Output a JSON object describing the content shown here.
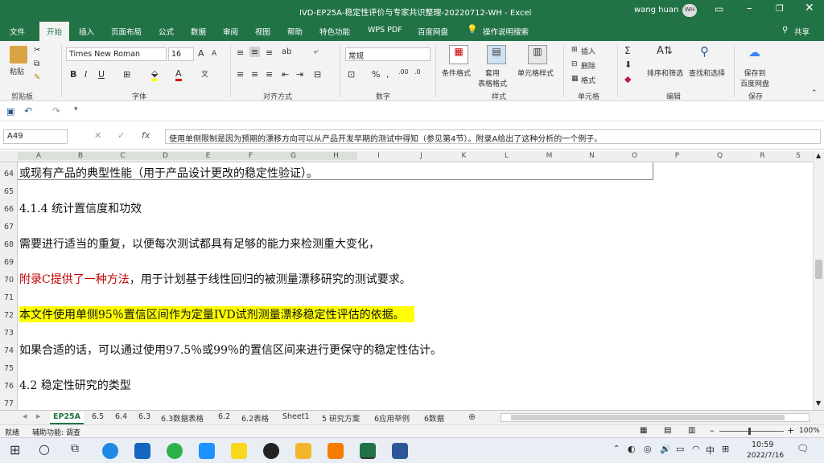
{
  "window": {
    "title": "IVD-EP25A-稳定性评价与专家共识整理-20220712-WH  -  Excel",
    "user": "wang huan",
    "avatar": "WH",
    "share": "共享"
  },
  "tabs": [
    "文件",
    "开始",
    "插入",
    "页面布局",
    "公式",
    "数据",
    "审阅",
    "视图",
    "帮助",
    "特色功能",
    "WPS PDF",
    "百度网盘",
    "操作说明搜索"
  ],
  "active_tab": "开始",
  "ribbon": {
    "paste": "粘贴",
    "font_name": "Times New Roman",
    "font_size": "16",
    "number_format": "常规",
    "cond_format": "条件格式",
    "table_format": "套用\n表格格式",
    "cell_style": "单元格样式",
    "insert": "插入",
    "delete": "删除",
    "format": "格式",
    "sort_filter": "排序和筛选",
    "find_select": "查找和选择",
    "save_baidu": "保存到\n百度网盘",
    "groups": [
      "剪贴板",
      "字体",
      "对齐方式",
      "数字",
      "样式",
      "单元格",
      "编辑",
      "保存"
    ]
  },
  "formula_bar": {
    "name_box": "A49",
    "fx": "fx",
    "content": "使用单侧限制是因为预期的漂移方向可以从产品开发早期的测试中得知（参见第4节）。附录A给出了这种分析的一个例子。"
  },
  "columns": [
    "A",
    "B",
    "C",
    "D",
    "E",
    "F",
    "G",
    "H",
    "I",
    "J",
    "K",
    "L",
    "M",
    "N",
    "O",
    "P",
    "Q",
    "R",
    "S"
  ],
  "rows": [
    {
      "num": "64",
      "text": "或现有产品的典型性能（用于产品设计更改的稳定性验证）。",
      "style": ""
    },
    {
      "num": "65",
      "text": "",
      "style": ""
    },
    {
      "num": "66",
      "text": "4.1.4 统计置信度和功效",
      "style": ""
    },
    {
      "num": "67",
      "text": "",
      "style": ""
    },
    {
      "num": "68",
      "text": "需要进行适当的重复，以便每次测试都具有足够的能力来检测重大变化，",
      "style": ""
    },
    {
      "num": "69",
      "text": "",
      "style": ""
    },
    {
      "num": "70",
      "text_red": "附录C提供了一种方法",
      "text": "，用于计划基于线性回归的被测量漂移研究的测试要求。",
      "style": "red"
    },
    {
      "num": "71",
      "text": "",
      "style": ""
    },
    {
      "num": "72",
      "text": "本文件使用单侧95％置信区间作为定量IVD试剂测量漂移稳定性评估的依据。",
      "style": "hl"
    },
    {
      "num": "73",
      "text": "",
      "style": ""
    },
    {
      "num": "74",
      "text": "如果合适的话，可以通过使用97.5％或99％的置信区间来进行更保守的稳定性估计。",
      "style": ""
    },
    {
      "num": "75",
      "text": "",
      "style": ""
    },
    {
      "num": "76",
      "text": "4.2 稳定性研究的类型",
      "style": ""
    },
    {
      "num": "77",
      "text": "",
      "style": ""
    }
  ],
  "sheet_tabs": [
    "EP25A",
    "6.5",
    "6.4",
    "6.3",
    "6.3数据表格",
    "6.2",
    "6.2表格",
    "Sheet1",
    "5 研究方案",
    "6应用举例",
    "6数据"
  ],
  "active_sheet": "EP25A",
  "status": {
    "ready": "就绪",
    "accessibility": "辅助功能: 调查",
    "zoom": "100%"
  },
  "taskbar": {
    "time": "10:59",
    "date": "2022/7/16",
    "ime": "中"
  },
  "colors": {
    "excel_green": "#217346",
    "highlight": "#ffff00",
    "red_text": "#c00000"
  }
}
